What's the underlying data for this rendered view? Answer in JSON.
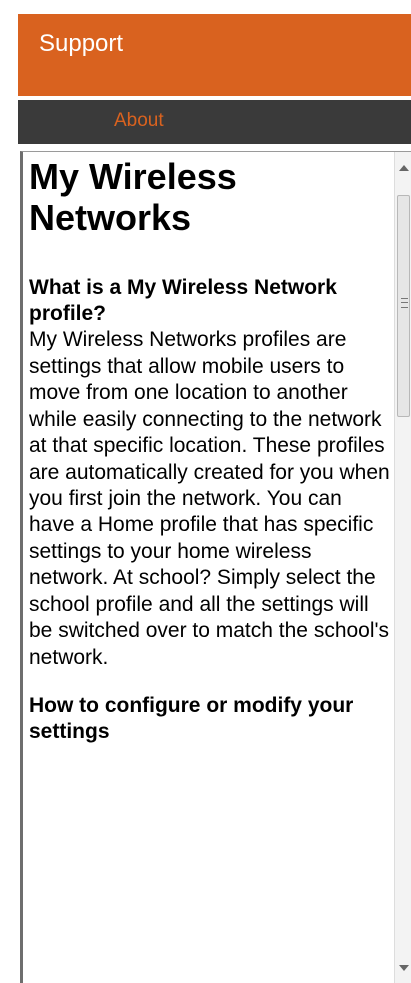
{
  "header": {
    "title": "Support"
  },
  "nav": {
    "about_label": "About"
  },
  "content": {
    "title": "My Wireless Networks",
    "section1_heading": "What is a My Wireless Network profile?",
    "section1_text": "My Wireless Networks profiles are settings that allow mobile users to move from one location to another while easily connecting to the network at that specific location.  These profiles are automatically created for you when you first join the network.  You can have a Home profile that has specific settings to your home wireless network.  At school? Simply select the school profile and all the settings will be switched over to match the school's network.",
    "section2_heading": "How to configure or modify your settings"
  },
  "colors": {
    "accent": "#d9621f",
    "nav_bg": "#3a3a3a"
  },
  "icons": {
    "scroll_up": "scroll-up-arrow-icon",
    "scroll_down": "scroll-down-arrow-icon"
  }
}
